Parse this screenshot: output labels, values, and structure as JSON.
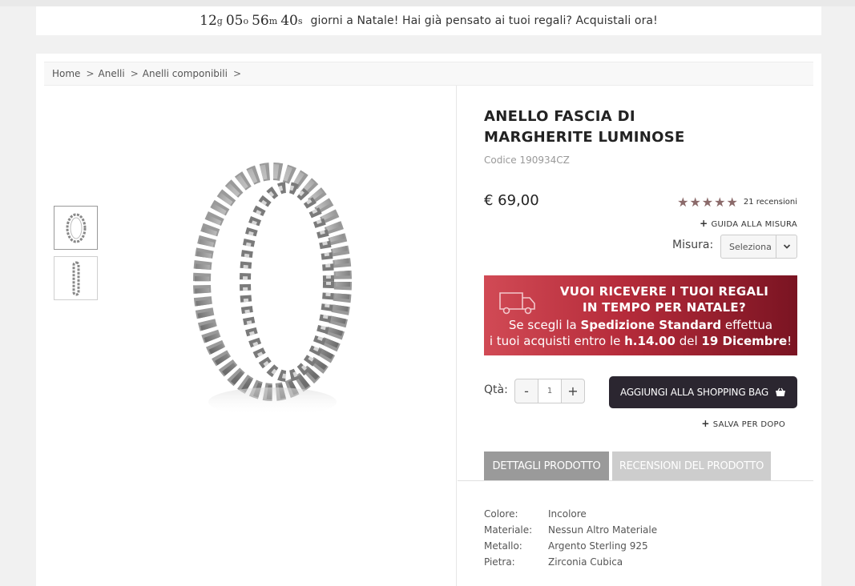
{
  "countdown": {
    "days": "12",
    "days_unit": "g",
    "hours": "05",
    "hours_unit": "o",
    "minutes": "56",
    "minutes_unit": "m",
    "seconds": "40",
    "seconds_unit": "s",
    "message": "giorni a Natale! Hai già pensato ai tuoi regali? Acquistali ora!"
  },
  "breadcrumb": {
    "items": [
      "Home",
      "Anelli",
      "Anelli componibili"
    ],
    "separator": ">"
  },
  "product": {
    "title": "ANELLO FASCIA DI MARGHERITE LUMINOSE",
    "code": "Codice 190934CZ",
    "price": "€ 69,00",
    "rating_stars": "★★★★★",
    "rating_value": 5,
    "reviews": "21 recensioni",
    "size_guide": "GUIDA ALLA MISURA",
    "size_label": "Misura:",
    "size_value": "Seleziona"
  },
  "promo": {
    "line1": "VUOI RICEVERE I TUOI REGALI",
    "line2": "IN TEMPO PER NATALE?",
    "line3_pre": "Se scegli la ",
    "line3_bold": "Spedizione Standard",
    "line3_post": " effettua",
    "line4_pre": "i tuoi acquisti entro le ",
    "line4_bold1": "h.14.00",
    "line4_mid": " del ",
    "line4_bold2": "19 Dicembre",
    "line4_post": "!",
    "icon": "delivery-truck-icon"
  },
  "purchase": {
    "qty_label": "Qtà:",
    "qty_minus": "-",
    "qty_value": "1",
    "qty_plus": "+",
    "add_to_bag": "AGGIUNGI ALLA SHOPPING BAG",
    "save_later": "SALVA PER DOPO"
  },
  "tabs": {
    "details": "DETTAGLI PRODOTTO",
    "reviews": "RECENSIONI DEL PRODOTTO"
  },
  "specs": [
    {
      "key": "Colore:",
      "value": "Incolore"
    },
    {
      "key": "Materiale:",
      "value": "Nessun Altro Materiale"
    },
    {
      "key": "Metallo:",
      "value": "Argento Sterling 925"
    },
    {
      "key": "Pietra:",
      "value": "Zirconia Cubica"
    }
  ],
  "colors": {
    "cta_bg": "#2b2630",
    "promo_start": "#d14a55",
    "promo_end": "#7a1422",
    "star": "#8b6a6a",
    "tab_active": "#9a9a9a",
    "tab_inactive": "#cdcdcd"
  }
}
